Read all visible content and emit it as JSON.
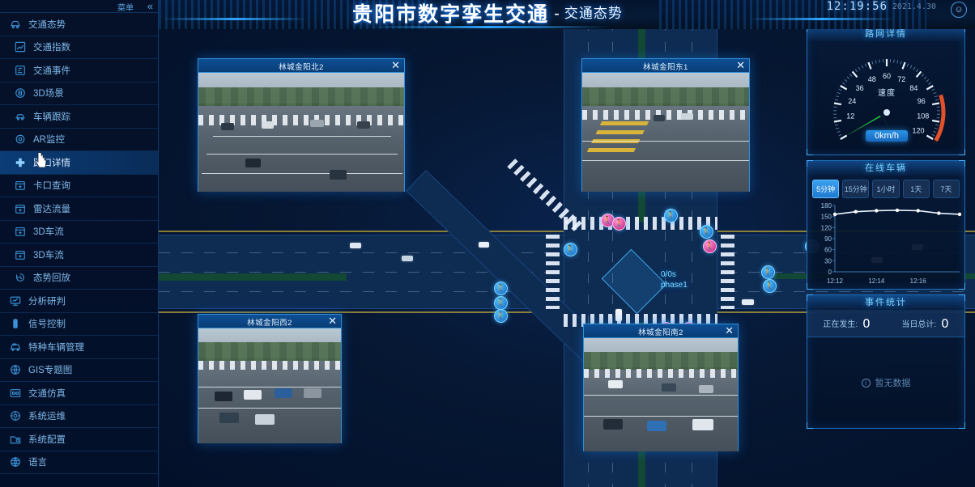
{
  "header": {
    "title": "贵阳市数字孪生交通",
    "separator": "-",
    "subtitle": "交通态势",
    "time": "12:19:56",
    "date": "2021.4.30",
    "avatar_icon": "user-avatar-icon"
  },
  "sidebar": {
    "menu_label": "菜单",
    "collapse_icon": "«",
    "items": [
      {
        "label": "交通态势",
        "icon": "traffic-situation-icon",
        "active": false,
        "level": "group"
      },
      {
        "label": "交通指数",
        "icon": "chart-index-icon",
        "active": false,
        "level": "child"
      },
      {
        "label": "交通事件",
        "icon": "event-icon",
        "active": false,
        "level": "child"
      },
      {
        "label": "3D场景",
        "icon": "cube-3d-icon",
        "active": false,
        "level": "child"
      },
      {
        "label": "车辆跟踪",
        "icon": "car-track-icon",
        "active": false,
        "level": "child"
      },
      {
        "label": "AR监控",
        "icon": "ar-monitor-icon",
        "active": false,
        "level": "child"
      },
      {
        "label": "路口详情",
        "icon": "intersection-icon",
        "active": true,
        "level": "child"
      },
      {
        "label": "卡口查询",
        "icon": "checkpoint-icon",
        "active": false,
        "level": "child"
      },
      {
        "label": "雷达流量",
        "icon": "radar-flow-icon",
        "active": false,
        "level": "child"
      },
      {
        "label": "3D车流",
        "icon": "flow-3d-icon",
        "active": false,
        "level": "child"
      },
      {
        "label": "3D车流",
        "icon": "flow-3d-icon",
        "active": false,
        "level": "child"
      },
      {
        "label": "态势回放",
        "icon": "playback-icon",
        "active": false,
        "level": "child"
      },
      {
        "label": "分析研判",
        "icon": "analysis-icon",
        "active": false,
        "level": "group"
      },
      {
        "label": "信号控制",
        "icon": "traffic-light-icon",
        "active": false,
        "level": "group"
      },
      {
        "label": "特种车辆管理",
        "icon": "special-vehicle-icon",
        "active": false,
        "level": "group"
      },
      {
        "label": "GIS专题图",
        "icon": "globe-icon",
        "active": false,
        "level": "group"
      },
      {
        "label": "交通仿真",
        "icon": "simulation-icon",
        "active": false,
        "level": "group"
      },
      {
        "label": "系统运维",
        "icon": "system-ops-icon",
        "active": false,
        "level": "group"
      },
      {
        "label": "系统配置",
        "icon": "settings-folder-icon",
        "active": false,
        "level": "group"
      },
      {
        "label": "语言",
        "icon": "language-globe-icon",
        "active": false,
        "level": "group"
      }
    ]
  },
  "cameras": [
    {
      "title": "林城金阳北2",
      "close_icon": "close-icon",
      "timestamp": ""
    },
    {
      "title": "林城金阳东1",
      "close_icon": "close-icon",
      "timestamp": ""
    },
    {
      "title": "林城金阳西2",
      "close_icon": "close-icon",
      "timestamp": ""
    },
    {
      "title": "林城金阳南2",
      "close_icon": "close-icon",
      "timestamp": ""
    }
  ],
  "scene": {
    "phase_line1": "0/0s",
    "phase_line2": "phase1"
  },
  "panels": {
    "gauge": {
      "title": "路网详情",
      "center_label": "速度",
      "value_label": "0km/h",
      "value": 0,
      "min": 0,
      "max": 120,
      "ticks": [
        12,
        24,
        36,
        48,
        60,
        72,
        84,
        96,
        108,
        120
      ],
      "needle_color": "#1fc13a",
      "danger_color": "#e2512a"
    },
    "online": {
      "title": "在线车辆",
      "tabs": [
        {
          "label": "5分钟",
          "active": true
        },
        {
          "label": "15分钟",
          "active": false
        },
        {
          "label": "1小时",
          "active": false
        },
        {
          "label": "1天",
          "active": false
        },
        {
          "label": "7天",
          "active": false
        }
      ]
    },
    "events": {
      "title": "事件统计",
      "ongoing_label": "正在发生:",
      "ongoing_value": "0",
      "today_label": "当日总计:",
      "today_value": "0",
      "empty_icon": "info-icon",
      "empty_text": "暂无数据"
    }
  },
  "chart_data": {
    "type": "line",
    "title": "在线车辆",
    "xlabel": "",
    "ylabel": "",
    "ylim": [
      0,
      180
    ],
    "yticks": [
      0,
      30,
      60,
      90,
      120,
      150,
      180
    ],
    "x": [
      "12:12",
      "12:13",
      "12:14",
      "12:15",
      "12:16",
      "12:17",
      "12:18"
    ],
    "xtick_labels": [
      "12:12",
      "12:14",
      "12:16"
    ],
    "series": [
      {
        "name": "在线车辆",
        "values": [
          156,
          163,
          166,
          167,
          166,
          159,
          156
        ],
        "color": "#e8f3ff"
      }
    ],
    "grid": false,
    "legend": "none"
  }
}
